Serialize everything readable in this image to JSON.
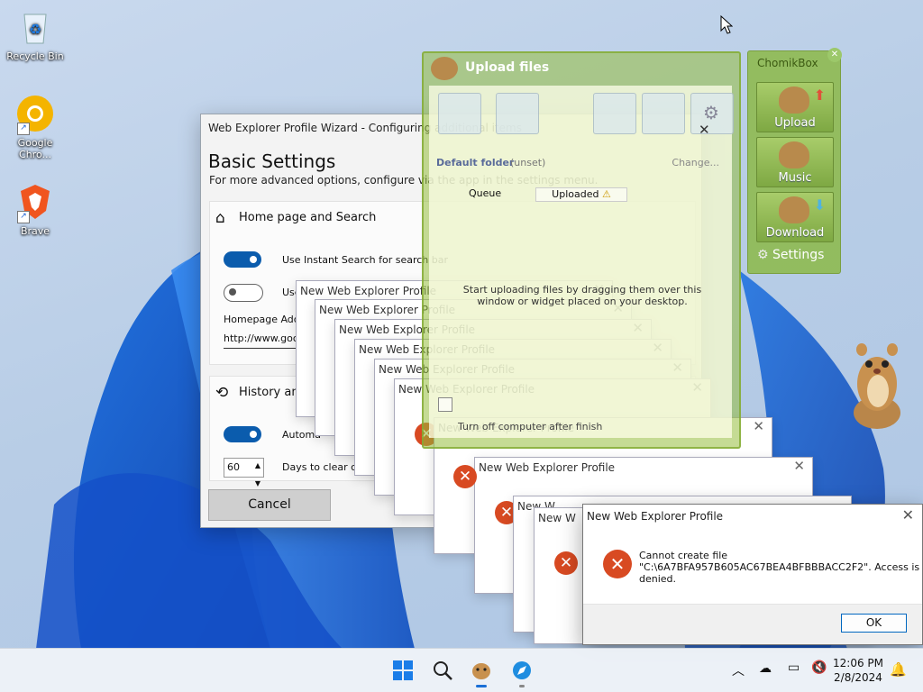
{
  "desktop": {
    "icons": [
      {
        "label": "Recycle Bin"
      },
      {
        "label": "Google Chro..."
      },
      {
        "label": "Brave"
      }
    ]
  },
  "wizard": {
    "title": "Web Explorer Profile Wizard - Configuring additional items",
    "heading": "Basic Settings",
    "subheading": "For more advanced options, configure via the app in the settings menu.",
    "section1_title": "Home page and Search",
    "instant_search_label": "Use Instant Search for search bar",
    "second_toggle_label": "Use",
    "homepage_label": "Homepage Addre",
    "homepage_value": "http://www.goo",
    "section2_title": "History and",
    "auto_label": "Automa",
    "days_value": "60",
    "days_label": "Days to clear cac",
    "cancel_label": "Cancel"
  },
  "profile_windows": {
    "title": "New Web Explorer Profile",
    "title_short": "New W"
  },
  "upload": {
    "title": "Upload files",
    "default_folder_label": "Default folder",
    "default_folder_value": "(unset)",
    "change_label": "Change...",
    "tab_queue": "Queue",
    "tab_uploaded": "Uploaded",
    "drop_hint": "Start uploading files by dragging them over this window or widget placed on your desktop.",
    "turn_off_label": "Turn off computer after finish"
  },
  "chomikbox": {
    "title": "ChomikBox",
    "upload_label": "Upload",
    "music_label": "Music",
    "download_label": "Download",
    "settings_label": "Settings"
  },
  "error_dialog": {
    "title": "New Web Explorer Profile",
    "message_line1": "Cannot create file",
    "message_line2": "\"C:\\6A7BFA957B605AC67BEA4BFBBBACC2F2\". Access is",
    "message_line3": "denied.",
    "ok_label": "OK"
  },
  "taskbar": {
    "time": "12:06 PM",
    "date": "2/8/2024"
  }
}
